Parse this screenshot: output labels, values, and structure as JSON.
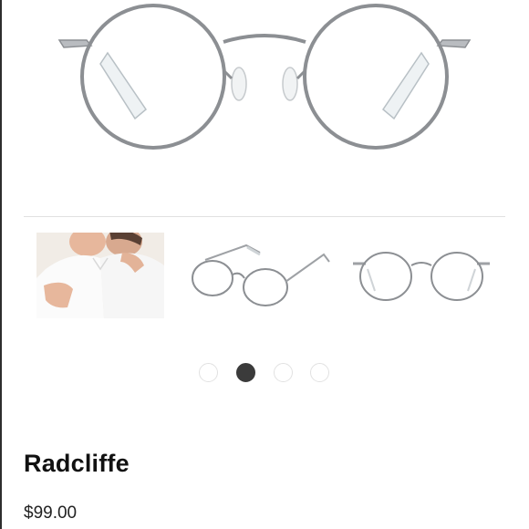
{
  "product": {
    "name": "Radcliffe",
    "price": "$99.00"
  },
  "gallery": {
    "thumbnails": [
      {
        "kind": "model-photo-thumbnail"
      },
      {
        "kind": "frame-angled-thumbnail"
      },
      {
        "kind": "frame-front-thumbnail"
      }
    ],
    "slides_total": 4,
    "active_slide": 2
  },
  "colors": {
    "frame_metal": "#8c8f93",
    "active_dot": "#3b3b3b",
    "inactive_dot_border": "#e2e2e2",
    "divider": "#e0e0e0"
  }
}
